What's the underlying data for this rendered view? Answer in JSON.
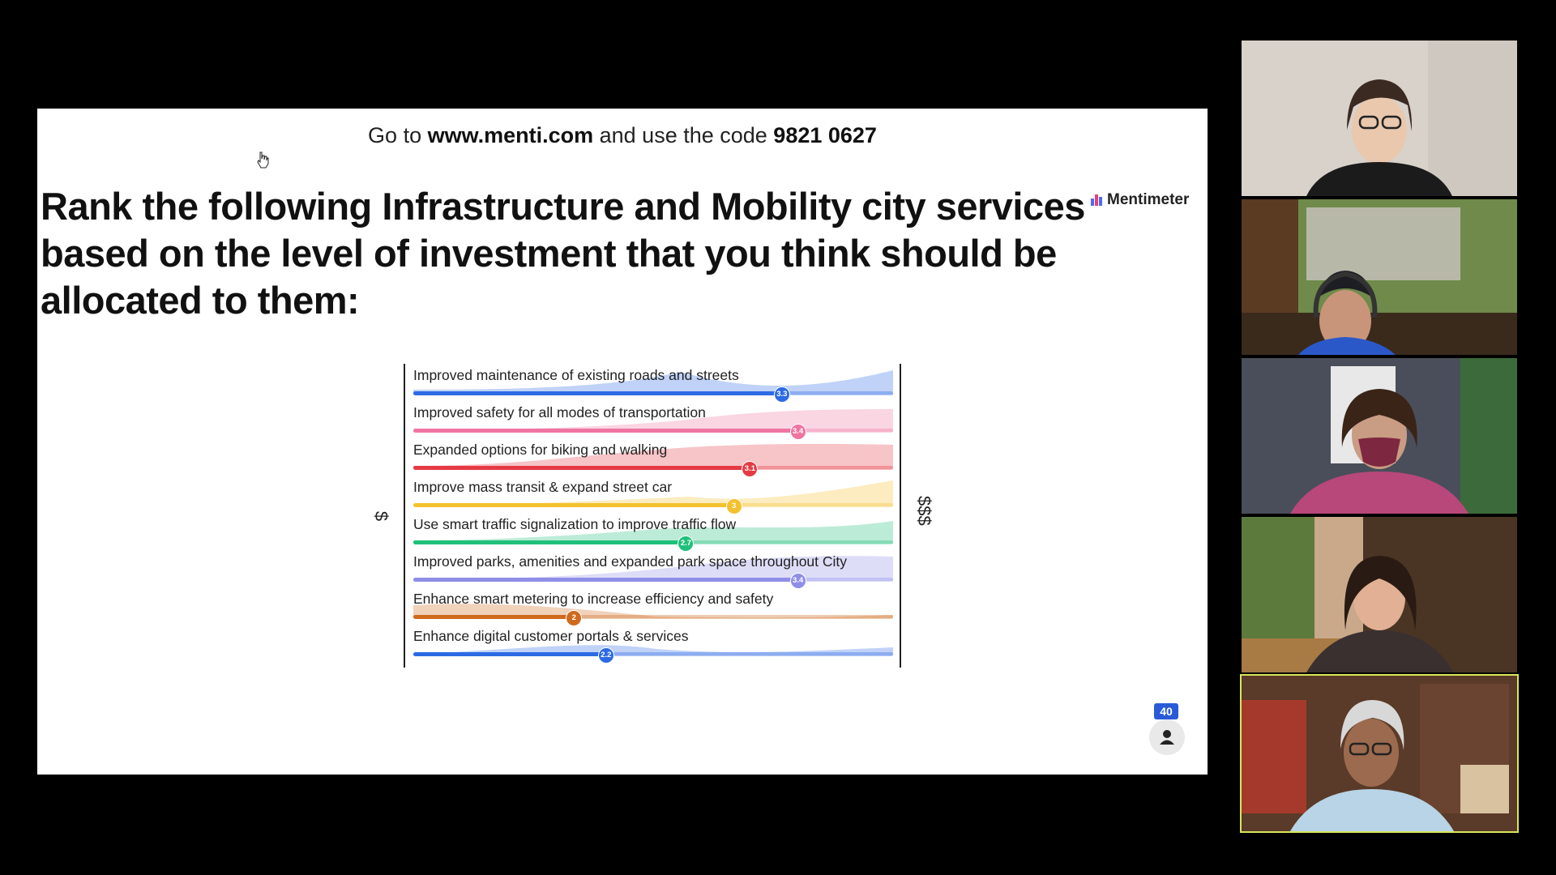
{
  "slide": {
    "join_prefix": "Go to ",
    "join_url": "www.menti.com",
    "join_middle": " and use the code ",
    "join_code": "9821 0627",
    "title": "Rank the following Infrastructure and Mobility city services based on the level of investment that you think should be allocated to them:",
    "brand_name": "Mentimeter"
  },
  "chart_data": {
    "type": "bar",
    "axis_low_label": "$",
    "axis_high_label": "$$$",
    "xlim": [
      1,
      4
    ],
    "items": [
      {
        "label": "Improved maintenance of existing roads and streets",
        "value": 3.3,
        "value_label": "3.3",
        "color": "#2d6be4"
      },
      {
        "label": "Improved safety for all modes of transportation",
        "value": 3.4,
        "value_label": "3.4",
        "color": "#f075a0"
      },
      {
        "label": "Expanded options for biking and walking",
        "value": 3.1,
        "value_label": "3.1",
        "color": "#e53a44"
      },
      {
        "label": "Improve mass transit & expand street car",
        "value": 3,
        "value_label": "3",
        "color": "#f4c12e"
      },
      {
        "label": "Use smart traffic signalization to improve traffic flow",
        "value": 2.7,
        "value_label": "2.7",
        "color": "#20c07a"
      },
      {
        "label": "Improved parks, amenities and expanded park space throughout City",
        "value": 3.4,
        "value_label": "3.4",
        "color": "#8f8ee8"
      },
      {
        "label": "Enhance smart metering to increase efficiency and safety",
        "value": 2,
        "value_label": "2",
        "color": "#cf6a1d"
      },
      {
        "label": "Enhance digital customer portals & services",
        "value": 2.2,
        "value_label": "2.2",
        "color": "#2d6be4"
      }
    ]
  },
  "participants": {
    "count": "40"
  },
  "colors": {
    "active_speaker_border": "#d8e65a",
    "participant_badge": "#2a5bd7"
  }
}
